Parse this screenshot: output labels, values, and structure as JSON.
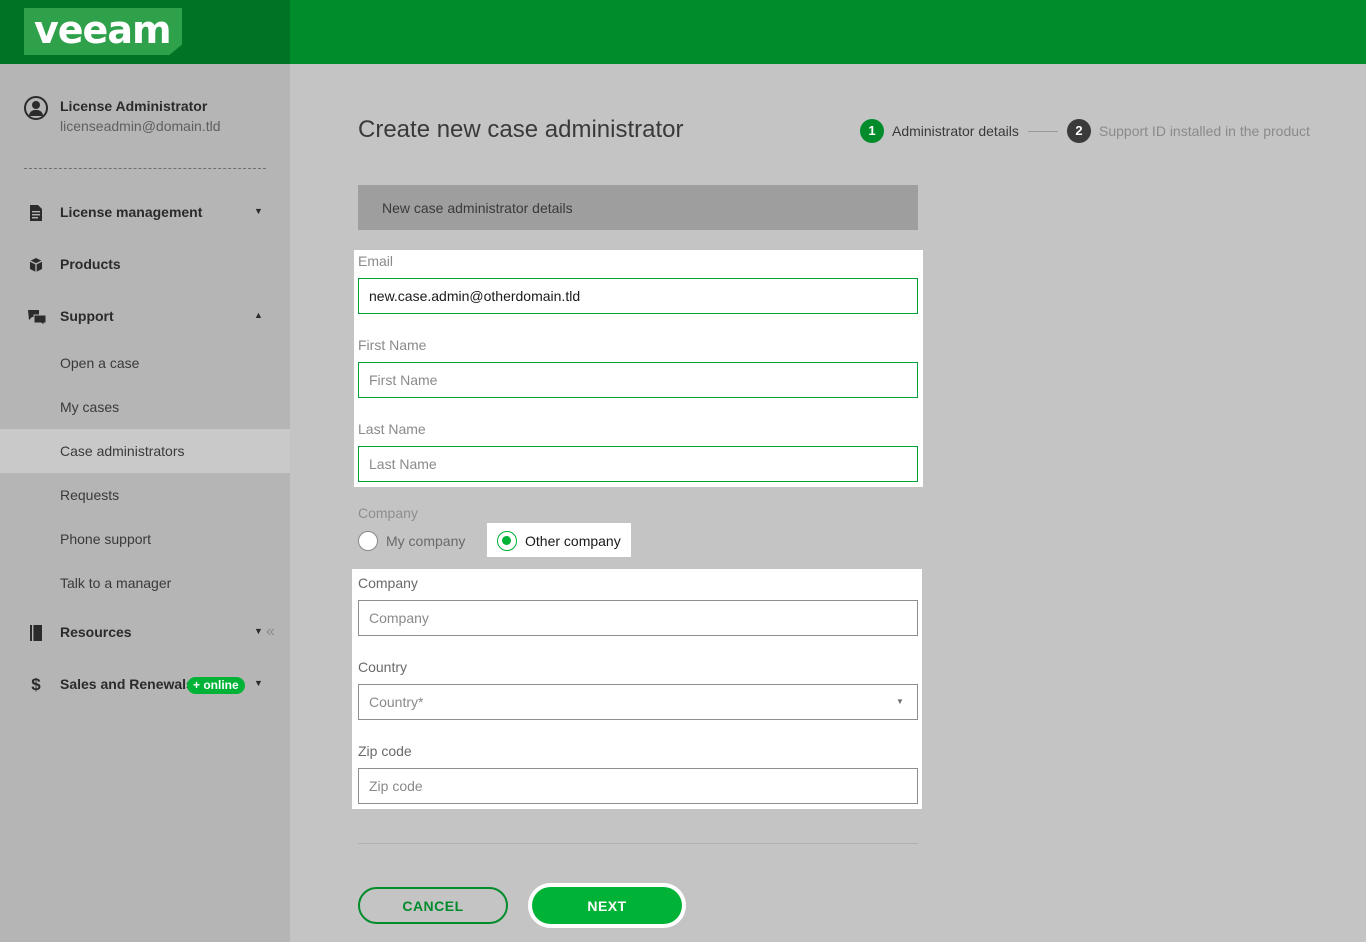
{
  "header": {
    "logo_text": "veeam",
    "brand_color": "#008c2b",
    "accent_color": "#00b336"
  },
  "user": {
    "name": "License Administrator",
    "email": "licenseadmin@domain.tld"
  },
  "sidebar": {
    "license_management": {
      "label": "License management",
      "icon": "document-icon"
    },
    "products": {
      "label": "Products",
      "icon": "box-icon"
    },
    "support": {
      "label": "Support",
      "icon": "chat-icon",
      "items": [
        "Open a case",
        "My cases",
        "Case administrators",
        "Requests",
        "Phone support",
        "Talk to a manager"
      ],
      "active": "Case administrators"
    },
    "resources": {
      "label": "Resources",
      "icon": "book-icon"
    },
    "sales": {
      "label": "Sales and Renewals",
      "badge": "+ online",
      "icon": "dollar-icon"
    }
  },
  "page": {
    "title": "Create new case administrator",
    "steps": [
      {
        "num": "1",
        "label": "Administrator details",
        "active": true
      },
      {
        "num": "2",
        "label": "Support ID installed in the product",
        "active": false
      }
    ],
    "section_header": "New case administrator details"
  },
  "form": {
    "email": {
      "label": "Email",
      "value": "new.case.admin@otherdomain.tld"
    },
    "first_name": {
      "label": "First Name",
      "placeholder": "First Name"
    },
    "last_name": {
      "label": "Last Name",
      "placeholder": "Last Name"
    },
    "company_choice": {
      "label": "Company",
      "option_my": "My company",
      "option_other": "Other company",
      "selected": "Other company"
    },
    "company": {
      "label": "Company",
      "placeholder": "Company"
    },
    "country": {
      "label": "Country",
      "placeholder": "Country*"
    },
    "zip": {
      "label": "Zip code",
      "placeholder": "Zip code"
    }
  },
  "buttons": {
    "cancel": "CANCEL",
    "next": "NEXT"
  }
}
